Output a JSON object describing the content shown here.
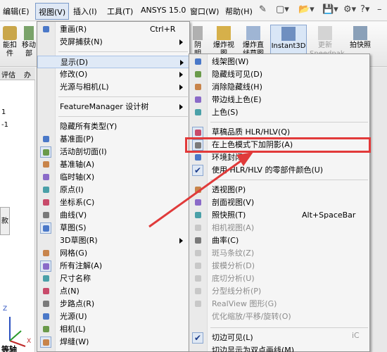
{
  "menubar": {
    "items": [
      "编辑(E)",
      "视图(V)",
      "插入(I)",
      "工具(T)",
      "ANSYS 15.0",
      "窗口(W)",
      "帮助(H)"
    ]
  },
  "ribbon": {
    "left_labels": [
      "能扣",
      "件"
    ],
    "left2_labels": [
      "移动",
      "部"
    ],
    "buttons": [
      {
        "label": "阴",
        "sub": "明"
      },
      {
        "label": "爆炸视",
        "sub": "图"
      },
      {
        "label": "爆炸直",
        "sub": "线草图"
      },
      {
        "label": "Instant3D",
        "sub": ""
      },
      {
        "label": "更新",
        "sub": "Speedpak"
      },
      {
        "label": "拍快照",
        "sub": ""
      }
    ]
  },
  "tabstrip": {
    "labels": [
      "评估",
      "办"
    ]
  },
  "leftpane": {
    "label": "款",
    "marks": [
      "1",
      "-1"
    ]
  },
  "view_menu": {
    "items": [
      {
        "label": "重画(R)",
        "shortcut": "Ctrl+R",
        "icon": "redraw-icon"
      },
      {
        "label": "荧屏捕获(N)",
        "arrow": true
      },
      {
        "label": "显示(D)",
        "arrow": true,
        "hover": true
      },
      {
        "label": "修改(O)",
        "arrow": true
      },
      {
        "label": "光源与相机(L)",
        "arrow": true
      },
      {
        "label": "FeatureManager 设计树",
        "arrow": true
      },
      {
        "label": "隐藏所有类型(Y)"
      },
      {
        "label": "基准面(P)",
        "icon": "plane-icon"
      },
      {
        "label": "活动剖切面(I)",
        "icon": "section-plane-icon",
        "checked": true
      },
      {
        "label": "基准轴(A)",
        "icon": "axis-icon"
      },
      {
        "label": "临时轴(X)",
        "icon": "temp-axis-icon"
      },
      {
        "label": "原点(I)",
        "icon": "origin-icon"
      },
      {
        "label": "坐标系(C)",
        "icon": "coordinate-system-icon"
      },
      {
        "label": "曲线(V)",
        "icon": "curve-icon"
      },
      {
        "label": "草图(S)",
        "icon": "sketch-icon",
        "checked": true
      },
      {
        "label": "3D草图(R)",
        "arrow": true
      },
      {
        "label": "网格(G)",
        "icon": "grid-icon"
      },
      {
        "label": "所有注解(A)",
        "icon": "annotation-icon",
        "checked": true
      },
      {
        "label": "尺寸名称",
        "icon": "dimension-name-icon"
      },
      {
        "label": "点(N)",
        "icon": "point-icon"
      },
      {
        "label": "步路点(R)",
        "icon": "route-point-icon"
      },
      {
        "label": "光源(U)",
        "icon": "light-icon"
      },
      {
        "label": "相机(L)",
        "icon": "camera-icon"
      },
      {
        "label": "焊缝(W)",
        "icon": "weld-icon",
        "checked": true
      }
    ]
  },
  "display_menu": {
    "items": [
      {
        "label": "线架图(W)",
        "icon": "wireframe-icon"
      },
      {
        "label": "隐藏线可见(D)",
        "icon": "hidden-visible-icon"
      },
      {
        "label": "消除隐藏线(H)",
        "icon": "hidden-removed-icon"
      },
      {
        "label": "带边线上色(E)",
        "icon": "shaded-edges-icon"
      },
      {
        "label": "上色(S)",
        "icon": "shaded-icon"
      },
      {
        "label": "草稿品质 HLR/HLV(Q)",
        "icon": "draft-quality-icon",
        "checked": true
      },
      {
        "label": "在上色模式下加阴影(A)",
        "icon": "shadows-icon",
        "checked": true
      },
      {
        "label": "环境封闭",
        "icon": "ambient-occlusion-icon"
      },
      {
        "label": "使用 HLR/HLV 的零部件颜色(U)",
        "icon": "check-icon",
        "checked": true
      },
      {
        "label": "透视图(P)",
        "icon": "perspective-icon"
      },
      {
        "label": "剖面视图(V)",
        "icon": "section-view-icon"
      },
      {
        "label": "照快照(T)",
        "shortcut": "Alt+SpaceBar",
        "icon": "snapshot-icon"
      },
      {
        "label": "相机视图(A)",
        "icon": "camera-view-icon",
        "disabled": true
      },
      {
        "label": "曲率(C)",
        "icon": "curvature-icon"
      },
      {
        "label": "斑马条纹(Z)",
        "icon": "zebra-icon",
        "disabled": true
      },
      {
        "label": "拔模分析(D)",
        "icon": "draft-analysis-icon",
        "disabled": true
      },
      {
        "label": "底切分析(U)",
        "icon": "undercut-icon",
        "disabled": true
      },
      {
        "label": "分型线分析(P)",
        "icon": "parting-line-icon",
        "disabled": true
      },
      {
        "label": "RealView 图形(G)",
        "icon": "realview-icon",
        "disabled": true
      },
      {
        "label": "优化缩放/平移/旋转(O)",
        "disabled": true
      },
      {
        "label": "切边可见(L)",
        "icon": "check-icon",
        "checked": true
      },
      {
        "label": "切边显示为双点画线(M)"
      }
    ]
  },
  "bottom_left": {
    "label": "等轴",
    "axis_labels": [
      "Z",
      "X"
    ]
  },
  "watermark": "iC"
}
